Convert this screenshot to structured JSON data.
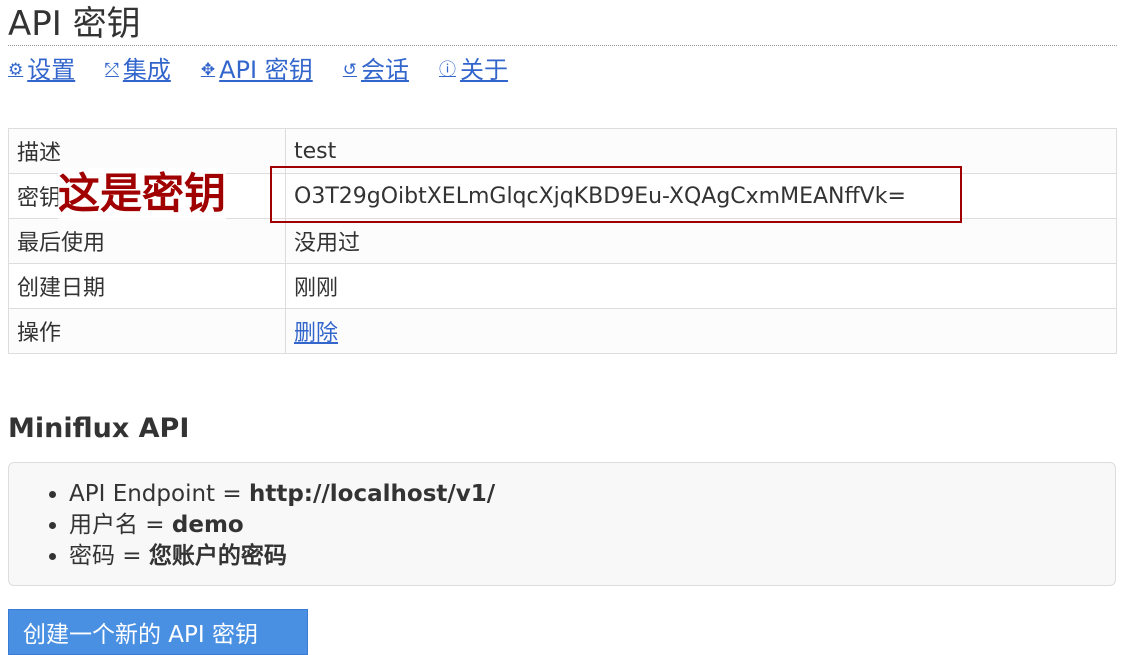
{
  "page": {
    "title": "API 密钥"
  },
  "nav": [
    {
      "icon": "settings-icon",
      "glyph": "⚙",
      "label": "设置"
    },
    {
      "icon": "integration-icon",
      "glyph": "⤱",
      "label": "集成"
    },
    {
      "icon": "api-icon",
      "glyph": "✥",
      "label": "API 密钥"
    },
    {
      "icon": "history-icon",
      "glyph": "↺",
      "label": "会话"
    },
    {
      "icon": "info-icon",
      "glyph": "ⓘ",
      "label": "关于"
    }
  ],
  "key_table": {
    "rows": [
      {
        "label": "描述",
        "value": "test"
      },
      {
        "label": "密钥",
        "value": "O3T29gOibtXELmGlqcXjqKBD9Eu-XQAgCxmMEANffVk="
      },
      {
        "label": "最后使用",
        "value": "没用过"
      },
      {
        "label": "创建日期",
        "value": "刚刚"
      },
      {
        "label": "操作",
        "value": "删除"
      }
    ]
  },
  "annotation": {
    "text": "这是密钥",
    "color": "#a00000"
  },
  "api_info": {
    "title": "Miniflux API",
    "items": [
      {
        "label": "API Endpoint = ",
        "value": "http://localhost/v1/"
      },
      {
        "label": "用户名 = ",
        "value": "demo"
      },
      {
        "label": "密码 = ",
        "value": "您账户的密码"
      }
    ]
  },
  "create_button": {
    "label": "创建一个新的 API 密钥"
  },
  "colors": {
    "link": "#3366cc",
    "button": "#4a90e2",
    "annotation": "#a00000"
  }
}
